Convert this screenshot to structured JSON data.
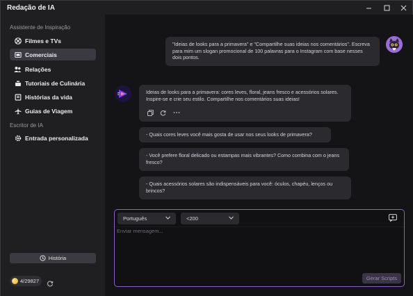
{
  "window": {
    "title": "Redação de IA"
  },
  "sidebar": {
    "section1_label": "Assistente de Inspiração",
    "items": [
      {
        "label": "Filmes e TVs",
        "icon": "film-reel-icon",
        "active": false
      },
      {
        "label": "Comerciais",
        "icon": "megaphone-icon",
        "active": true
      },
      {
        "label": "Relações",
        "icon": "people-icon",
        "active": false
      },
      {
        "label": "Tutoriais de Culinária",
        "icon": "cooking-icon",
        "active": false
      },
      {
        "label": "Histórias da vida",
        "icon": "book-icon",
        "active": false
      },
      {
        "label": "Guias de Viagem",
        "icon": "airplane-icon",
        "active": false
      }
    ],
    "section2_label": "Escritor de IA",
    "custom_item": {
      "label": "Entrada personalizada",
      "icon": "gear-icon"
    },
    "history_label": "História",
    "credits": "4/29827"
  },
  "chat": {
    "user_message": "\"Ideias de looks para a primavera\" e \"Compartilhe suas ideias nos comentários\". Escreva para mim um slogan promocional de 100 palavras para o Instagram com base nesses dois pontos.",
    "ai_message": "Ideias de looks para a primavera: cores leves, floral, jeans fresco e acessórios solares. Inspire-se e crie seu estilo. Compartilhe nos comentários suas ideias!",
    "suggestions": [
      "- Quais cores leves você mais gosta de usar nos seus looks de primavera?",
      "- Você prefere floral delicado ou estampas mais vibrantes? Como combina com o jeans fresco?",
      "- Quais acessórios solares são indispensáveis para você: óculos, chapéu, lenços ou brincos?"
    ]
  },
  "composer": {
    "language": "Português",
    "length": "<200",
    "placeholder": "Enviar mensagem...",
    "generate_label": "Gerar Scripts"
  },
  "colors": {
    "accent": "#8a5fd0",
    "active_item_bg": "#3a3a40",
    "bubble_bg": "#2a2a2f"
  }
}
